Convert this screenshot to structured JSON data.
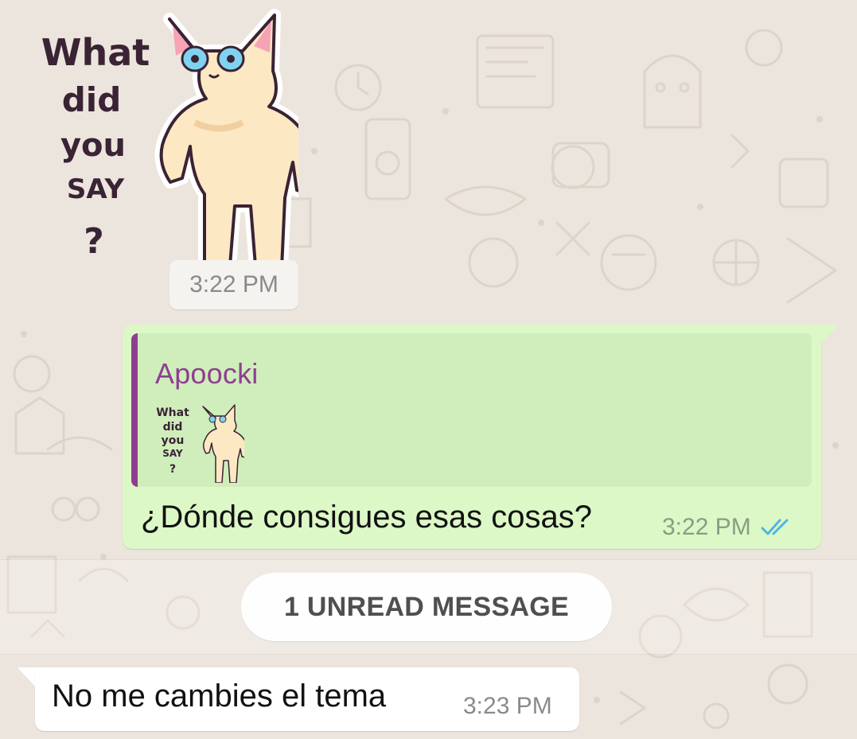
{
  "theme": {
    "outgoing_bg": "#dcf8c6",
    "incoming_bg": "#ffffff",
    "quote_accent": "#8e3e91",
    "read_tick_color": "#4fb5e5",
    "wallpaper_bg": "#ece5dd"
  },
  "sticker_message": {
    "sticker_text": [
      "What",
      "did",
      "you",
      "SAY",
      "?"
    ],
    "time": "3:22 PM"
  },
  "outgoing_message": {
    "quoted_author": "Apoocki",
    "quoted_sticker_text": [
      "What",
      "did",
      "you",
      "SAY",
      "?"
    ],
    "text": "¿Dónde consigues esas cosas?",
    "time": "3:22 PM",
    "status_icon": "double-check-read-icon"
  },
  "unread_divider": {
    "label": "1 UNREAD MESSAGE"
  },
  "incoming_message": {
    "text": "No me cambies el tema",
    "time": "3:23 PM"
  }
}
